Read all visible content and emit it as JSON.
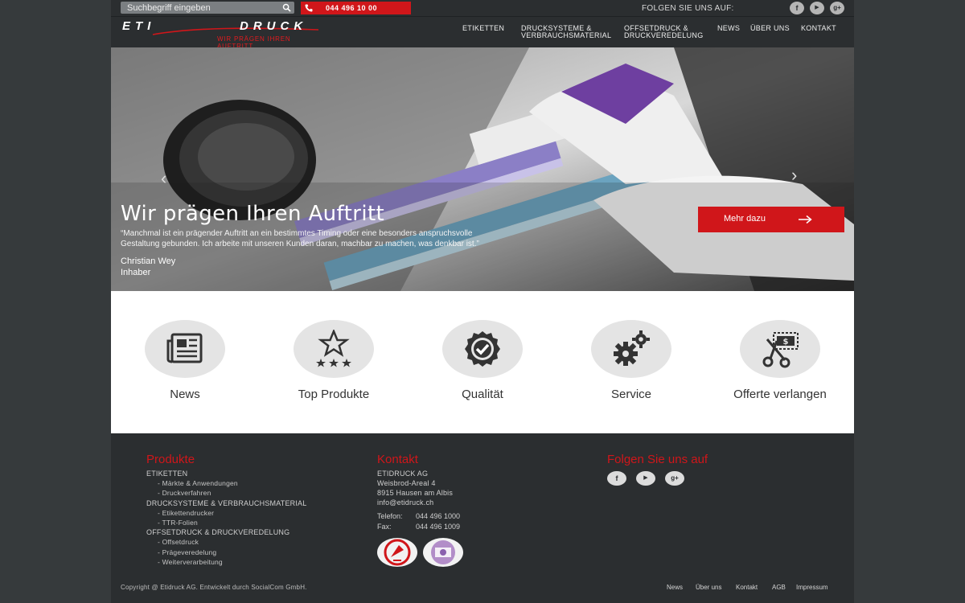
{
  "topbar": {
    "search_placeholder": "Suchbegriff eingeben",
    "phone": "044 496 10 00",
    "follow_label": "FOLGEN SIE UNS AUF:",
    "social": [
      {
        "icon": "facebook-icon",
        "glyph": "f"
      },
      {
        "icon": "youtube-icon",
        "glyph": "▶"
      },
      {
        "icon": "googleplus-icon",
        "glyph": "g+"
      }
    ]
  },
  "logo": {
    "word1": "ETI",
    "word2": "DRUCK",
    "tagline": "WIR PRÄGEN IHREN AUFTRITT"
  },
  "nav": [
    {
      "line1": "ETIKETTEN",
      "line2": ""
    },
    {
      "line1": "DRUCKSYSTEME &",
      "line2": "VERBRAUCHSMATERIAL"
    },
    {
      "line1": "OFFSETDRUCK &",
      "line2": "DRUCKVEREDELUNG"
    },
    {
      "line1": "NEWS",
      "line2": ""
    },
    {
      "line1": "ÜBER UNS",
      "line2": ""
    },
    {
      "line1": "KONTAKT",
      "line2": ""
    }
  ],
  "hero": {
    "title": "Wir prägen Ihren Auftritt",
    "quote_line1": "“Manchmal ist ein prägender Auftritt an ein bestimmtes Timing oder eine besonders anspruchsvolle",
    "quote_line2": "Gestaltung gebunden. Ich arbeite mit unseren Kunden daran, machbar zu machen, was denkbar ist.”",
    "author_name": "Christian Wey",
    "author_role": "Inhaber",
    "button": "Mehr dazu"
  },
  "features": [
    {
      "label": "News",
      "icon": "newspaper-icon"
    },
    {
      "label": "Top Produkte",
      "icon": "star-rating-icon"
    },
    {
      "label": "Qualität",
      "icon": "quality-seal-icon"
    },
    {
      "label": "Service",
      "icon": "gears-icon"
    },
    {
      "label": "Offerte verlangen",
      "icon": "scissors-coupon-icon"
    }
  ],
  "footer": {
    "produkte_title": "Produkte",
    "produkte": [
      {
        "label": "ETIKETTEN",
        "level": 0
      },
      {
        "label": "- Märkte & Anwendungen",
        "level": 1
      },
      {
        "label": "- Druckverfahren",
        "level": 1
      },
      {
        "label": "DRUCKSYSTEME & VERBRAUCHSMATERIAL",
        "level": 0
      },
      {
        "label": "- Etikettendrucker",
        "level": 1
      },
      {
        "label": "- TTR-Folien",
        "level": 1
      },
      {
        "label": "OFFSETDRUCK & DRUCKVEREDELUNG",
        "level": 0
      },
      {
        "label": "- Offsetdruck",
        "level": 1
      },
      {
        "label": "- Prägeveredelung",
        "level": 1
      },
      {
        "label": "- Weiterverarbeitung",
        "level": 1
      }
    ],
    "kontakt_title": "Kontakt",
    "company": "ETIDRUCK AG",
    "street": "Weisbrod-Areal 4",
    "city": "8915 Hausen am Albis",
    "email": "info@etidruck.ch",
    "tel_label": "Telefon:",
    "tel": "044 496 1000",
    "fax_label": "Fax:",
    "fax": "044 496 1009",
    "certs": [
      "swiss-quality-badge",
      "brc-certificate-badge"
    ],
    "follow_title": "Folgen Sie uns auf",
    "copyright": "Copyright @ Etidruck AG. Entwickelt durch SocialCom GmbH.",
    "bottom_nav": [
      "News",
      "Über uns",
      "Kontakt",
      "AGB",
      "Impressum"
    ]
  },
  "colors": {
    "accent": "#d0161a",
    "dark": "#2b2e30",
    "page_bg": "#363a3c"
  }
}
